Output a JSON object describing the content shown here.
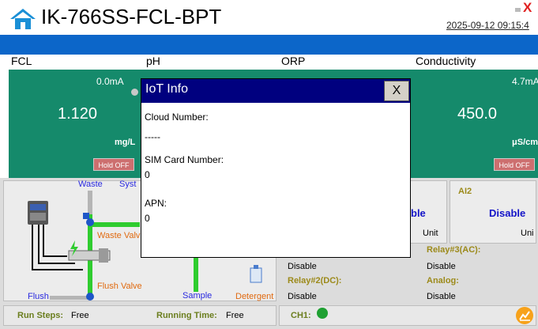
{
  "header": {
    "title": "IK-766SS-FCL-BPT",
    "datetime": "2025-09-12 09:15:4",
    "close_glyph": "X"
  },
  "channels": [
    {
      "name": "FCL",
      "current": "0.0mA",
      "value": "1.120",
      "unit": "mg/L",
      "hold": "Hold OFF"
    },
    {
      "name": "pH",
      "current": "",
      "value": "",
      "unit": "",
      "hold": ""
    },
    {
      "name": "ORP",
      "current": "",
      "value": "",
      "unit": "",
      "hold": ""
    },
    {
      "name": "Conductivity",
      "current": "4.7mA",
      "value": "450.0",
      "unit": "μS/cm",
      "hold": "Hold OFF"
    }
  ],
  "diagram": {
    "waste": "Waste",
    "system": "Syst",
    "waste_valve": "Waste Valv",
    "flush_valve": "Flush Valve",
    "sample": "Sample",
    "detergent": "Detergent",
    "flush": "Flush"
  },
  "ai_boxes": [
    {
      "title": "",
      "value": "ble",
      "unit": "Unit"
    },
    {
      "title": "AI2",
      "value": "Disable",
      "unit": "Uni"
    }
  ],
  "relays": [
    {
      "title": "Relay#3(AC):",
      "value": "Disable"
    },
    {
      "title": "Relay#2(DC):",
      "value": "Disable"
    },
    {
      "title": "Analog:",
      "value": "Disable"
    },
    {
      "title": "",
      "value": "Disable"
    },
    {
      "title": "",
      "value": "Disable"
    }
  ],
  "status": {
    "run_steps_label": "Run Steps:",
    "run_steps_value": "Free",
    "running_time_label": "Running Time:",
    "running_time_value": "Free",
    "ch1_label": "CH1:"
  },
  "modal": {
    "title": "IoT Info",
    "close": "X",
    "cloud_label": "Cloud Number:",
    "cloud_value": "-----",
    "sim_label": "SIM Card Number:",
    "sim_value": "0",
    "apn_label": "APN:",
    "apn_value": "0"
  },
  "colors": {
    "accent_blue": "#0c66c9",
    "panel_green": "#158a6b",
    "modal_head": "#00007f",
    "pipe_green": "#2fcc2f",
    "ch1_status": "#1fa032"
  }
}
